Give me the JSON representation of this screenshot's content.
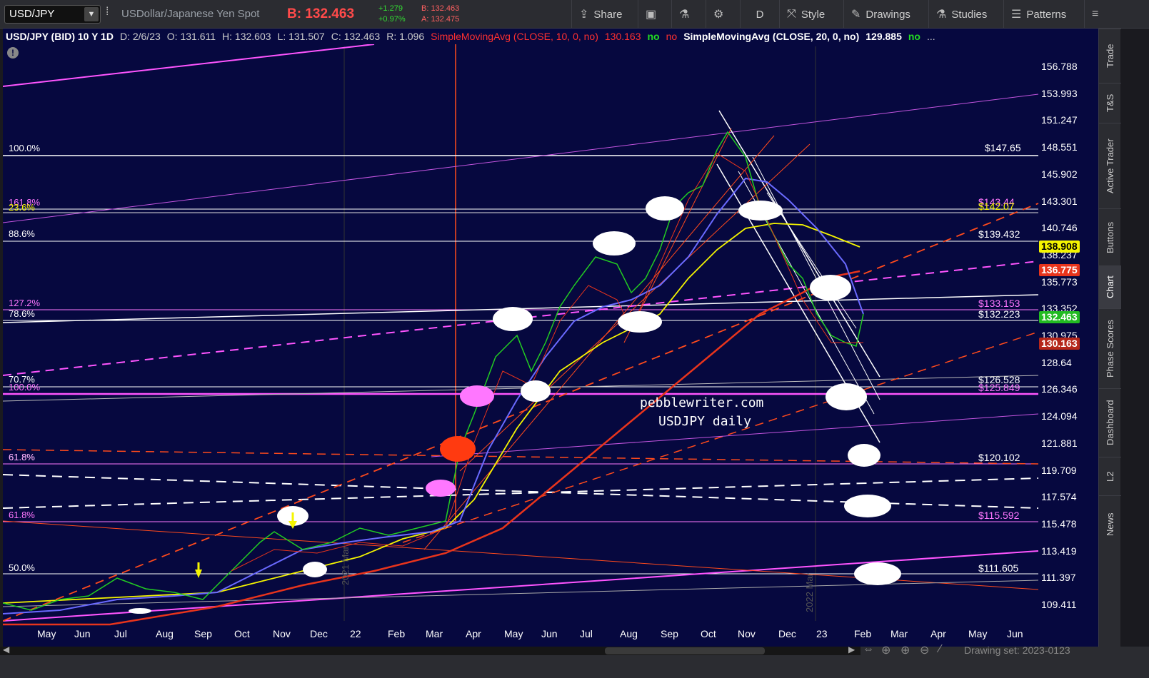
{
  "toolbar": {
    "symbol": "USD/JPY",
    "description": "USDollar/Japanese Yen Spot",
    "bid": "B: 132.463",
    "change_abs": "+1.279",
    "change_pct": "+0.97%",
    "bid_small": "B: 132.463",
    "ask_small": "A: 132.475",
    "share_label": "Share",
    "period_label": "D",
    "style_label": "Style",
    "drawings_label": "Drawings",
    "studies_label": "Studies",
    "patterns_label": "Patterns"
  },
  "infobar": {
    "title": "USD/JPY (BID) 10 Y 1D",
    "date": "D: 2/6/23",
    "open": "O: 131.611",
    "high": "H: 132.603",
    "low": "L: 131.507",
    "close": "C: 132.463",
    "range": "R: 1.096",
    "sma10": "SimpleMovingAvg (CLOSE, 10, 0, no)",
    "sma10_val": "130.163",
    "sma_no1": "no",
    "sma_no2": "no",
    "sma20": "SimpleMovingAvg (CLOSE, 20, 0, no)",
    "sma20_val": "129.885",
    "sma_no3": "no",
    "more": "..."
  },
  "yaxis": [
    "156.788",
    "153.993",
    "151.247",
    "148.551",
    "145.902",
    "143.301",
    "140.746",
    "138.237",
    "135.773",
    "133.352",
    "130.975",
    "128.64",
    "126.346",
    "124.094",
    "121.881",
    "119.709",
    "117.574",
    "115.478",
    "113.419",
    "111.397",
    "109.411"
  ],
  "xaxis": [
    "May",
    "Jun",
    "Jul",
    "Aug",
    "Sep",
    "Oct",
    "Nov",
    "Dec",
    "22",
    "Feb",
    "Mar",
    "Apr",
    "May",
    "Jun",
    "Jul",
    "Aug",
    "Sep",
    "Oct",
    "Nov",
    "Dec",
    "23",
    "Feb",
    "Mar",
    "Apr",
    "May",
    "Jun"
  ],
  "price_boxes": {
    "yellow": "138.908",
    "red1": "136.775",
    "green": "132.463",
    "red2": "130.163"
  },
  "colors": {
    "yellow": "#f5f500",
    "red": "#e8341c",
    "green": "#22bb22",
    "pink": "#ff55ff",
    "bg": "#06083f"
  },
  "fib_left": {
    "f100": "100.0%",
    "f1618": "161.8%",
    "f236": "23.6%",
    "f886": "88.6%",
    "f1272": "127.2%",
    "f786": "78.6%",
    "f707": "70.7%",
    "f1000b": "100.0%",
    "f618a": "61.8%",
    "f618b": "61.8%",
    "f50": "50.0%"
  },
  "price_labels": {
    "p14765": "$147.65",
    "p14344": "$143.44",
    "p14207": "$142.07",
    "p13943": "$139.432",
    "p13315": "$133.153",
    "p13222": "$132.223",
    "p12652": "$126.528",
    "p12584": "$125.849",
    "p12010": "$120.102",
    "p11559": "$115.592",
    "p11160": "$111.605"
  },
  "watermark": {
    "site": "pebblewriter.com",
    "sub": "USDJPY daily"
  },
  "year_marks": {
    "y2021": "2021 Mar",
    "y2022": "2022 Mar"
  },
  "sidebar": [
    "Trade",
    "T&S",
    "Active Trader",
    "Buttons",
    "Chart",
    "Phase Scores",
    "Dashboard",
    "L2",
    "News"
  ],
  "bottom": {
    "drawing_set": "Drawing set: 2023-0123"
  }
}
